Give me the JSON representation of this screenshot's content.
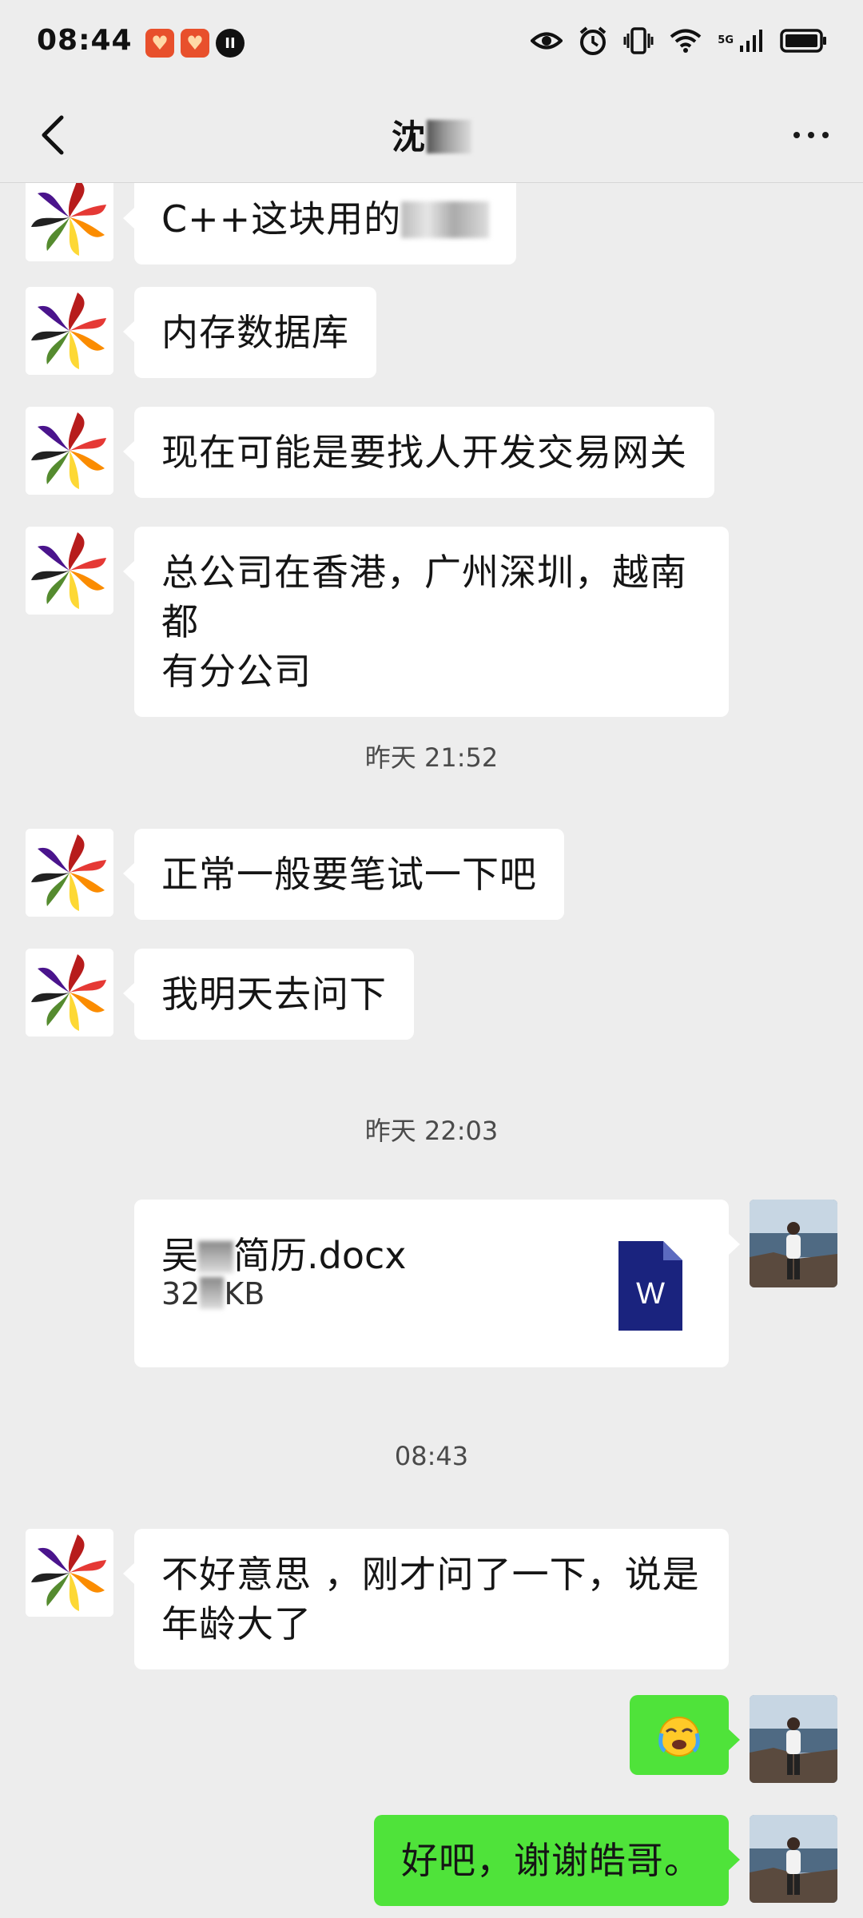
{
  "status_bar": {
    "time": "08:44",
    "left_icons": [
      "heart-badge-icon",
      "heart-badge-icon",
      "app-badge-icon"
    ],
    "network_label": "5G",
    "right_icons": [
      "eye-icon",
      "alarm-icon",
      "vibrate-icon",
      "wifi-icon",
      "signal-icon",
      "battery-icon"
    ]
  },
  "nav": {
    "title": "沈",
    "back_icon": "chevron-left-icon",
    "more_icon": "more-dots-icon"
  },
  "messages": [
    {
      "side": "in",
      "text": "C++这块用的"
    },
    {
      "side": "in",
      "text": "内存数据库"
    },
    {
      "side": "in",
      "text": "现在可能是要找人开发交易网关"
    },
    {
      "side": "in",
      "text_line1": "总公司在香港，广州深圳，越南都",
      "text_line2": "有分公司"
    },
    {
      "timestamp": "昨天 21:52"
    },
    {
      "side": "in",
      "text": "正常一般要笔试一下吧"
    },
    {
      "side": "in",
      "text": "我明天去问下"
    },
    {
      "timestamp": "昨天 22:03"
    },
    {
      "side": "out",
      "file": {
        "name_part1": "吴",
        "name_part2": "简历.docx",
        "size_part1": "32",
        "size_part2": "KB",
        "icon": "word-document-icon",
        "icon_letter": "W"
      }
    },
    {
      "timestamp": "08:43"
    },
    {
      "side": "in",
      "text_line1": "不好意思 ，刚才问了一下，说是",
      "text_line2": "年龄大了"
    },
    {
      "side": "out",
      "emoji": "crying-face-emoji"
    },
    {
      "side": "out",
      "text": "好吧，谢谢皓哥。"
    }
  ],
  "colors": {
    "background": "#ededed",
    "incoming_bubble": "#ffffff",
    "outgoing_bubble": "#4fe33a",
    "word_icon": "#1a237e"
  }
}
